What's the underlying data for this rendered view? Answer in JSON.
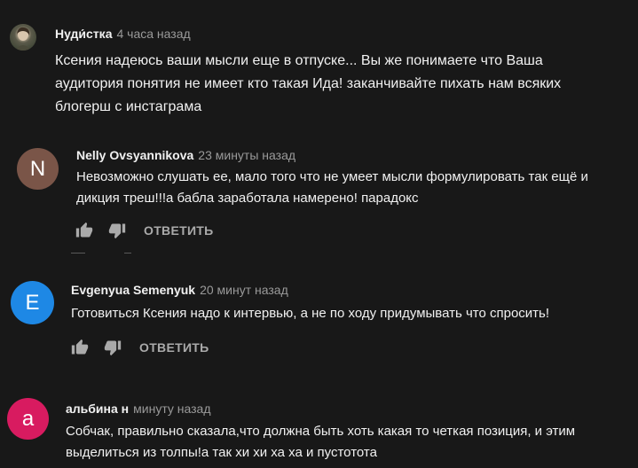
{
  "comments": [
    {
      "author": "Нуди́стка",
      "time": "4 часа назад",
      "text": "Ксения надеюсь ваши мысли еще в отпуске... Вы же понимаете что Ваша\nаудитория понятия не имеет кто такая Ида! заканчивайте пихать нам всяких\nблогерш с инстаграма",
      "avatar": {
        "type": "photo",
        "color": "#6b6a5a"
      }
    },
    {
      "author": "Nelly Ovsyannikova",
      "time": "23 минуты назад",
      "text": "Невозможно слушать ее, мало того что не умеет мысли формулировать так ещё и\nдикция треш!!!а бабла заработала намерено! парадокс",
      "avatar": {
        "letter": "N",
        "color": "#7a5548"
      },
      "reply_label": "ОТВЕТИТЬ"
    },
    {
      "author": "Evgenyua Semenyuk",
      "time": "20 минут назад",
      "text": "Готовиться Ксения надо к интервью, а не по ходу придумывать что спросить!",
      "avatar": {
        "letter": "E",
        "color": "#1e88e5"
      },
      "reply_label": "ОТВЕТИТЬ"
    },
    {
      "author": "альбина н",
      "time": "минуту назад",
      "text": "Собчак, правильно сказала,что должна быть хоть какая то четкая позиция, и этим\nвыделиться из толпы!а так хи хи ха ха и пустотота",
      "avatar": {
        "letter": "a",
        "color": "#d81b60"
      }
    }
  ],
  "icons": {
    "like": "thumb-up-icon",
    "dislike": "thumb-down-icon"
  }
}
